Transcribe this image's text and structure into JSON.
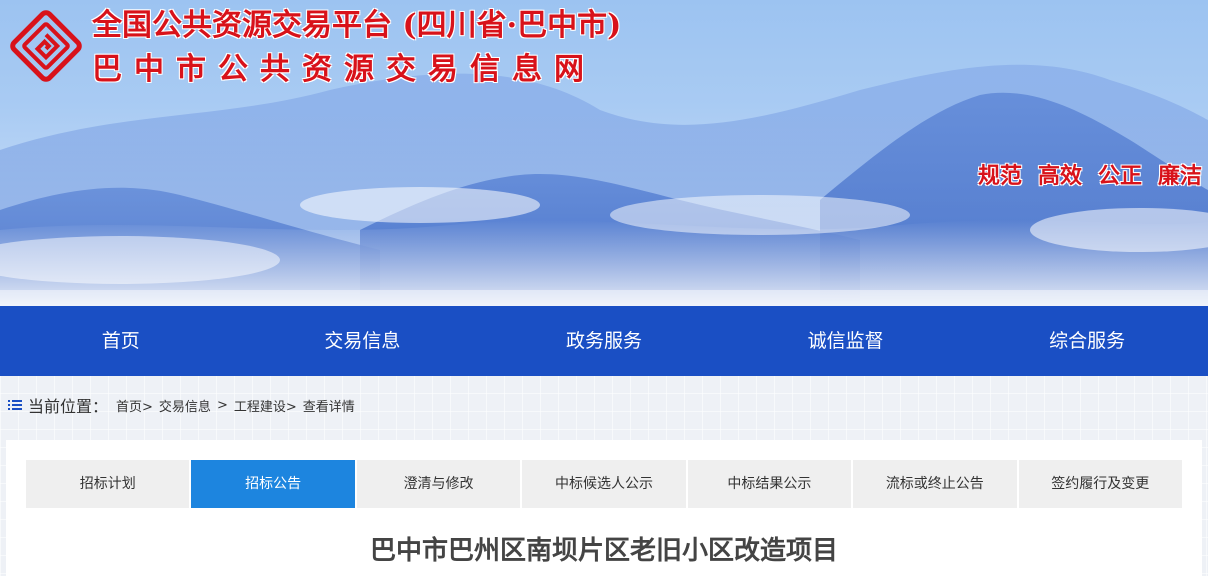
{
  "header": {
    "title_line1": "全国公共资源交易平台 (四川省·巴中市)",
    "title_line2": "巴中市公共资源交易信息网",
    "slogans": [
      "规范",
      "高效",
      "公正",
      "廉洁"
    ],
    "logo_icon": "fret-pattern-logo-icon",
    "brand_color": "#d8121a"
  },
  "nav": {
    "items": [
      "首页",
      "交易信息",
      "政务服务",
      "诚信监督",
      "综合服务"
    ],
    "background": "#1a4fc4"
  },
  "breadcrumb": {
    "label": "当前位置：",
    "items": [
      "首页>",
      "交易信息",
      ">",
      "工程建设>",
      "查看详情"
    ]
  },
  "tabs": {
    "items": [
      "招标计划",
      "招标公告",
      "澄清与修改",
      "中标候选人公示",
      "中标结果公示",
      "流标或终止公告",
      "签约履行及变更"
    ],
    "active": "招标公告",
    "active_color": "#1d85df"
  },
  "article": {
    "title": "巴中市巴州区南坝片区老旧小区改造项目"
  }
}
